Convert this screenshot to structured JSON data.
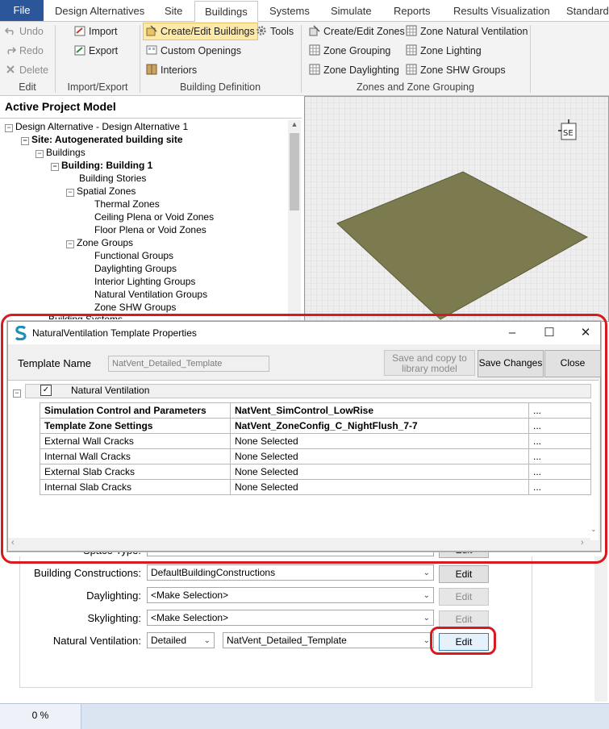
{
  "menu": {
    "file": "File",
    "tabs": [
      "Design Alternatives",
      "Site",
      "Buildings",
      "Systems",
      "Simulate",
      "Reports",
      "Results Visualization",
      "Standards"
    ]
  },
  "ribbon": {
    "edit": {
      "undo": "Undo",
      "redo": "Redo",
      "delete": "Delete",
      "label": "Edit"
    },
    "import_export": {
      "import": "Import",
      "export": "Export",
      "label": "Import/Export"
    },
    "building_definition": {
      "create_edit": "Create/Edit Buildings",
      "tools": "Tools",
      "custom_openings": "Custom Openings",
      "interiors": "Interiors",
      "label": "Building Definition"
    },
    "zones": {
      "create_edit_zones": "Create/Edit Zones",
      "zone_nat_vent": "Zone Natural Ventilation",
      "zone_grouping": "Zone Grouping",
      "zone_lighting": "Zone Lighting",
      "zone_daylighting": "Zone Daylighting",
      "zone_shw": "Zone SHW Groups",
      "label": "Zones and Zone Grouping"
    }
  },
  "left_panel": {
    "title": "Active Project Model",
    "tree": [
      "Design Alternative - Design Alternative 1",
      "Site: Autogenerated building site",
      "Buildings",
      "Building: Building 1",
      "Building Stories",
      "Spatial Zones",
      "Thermal Zones",
      "Ceiling Plena or Void Zones",
      "Floor Plena or Void Zones",
      "Zone Groups",
      "Functional Groups",
      "Daylighting Groups",
      "Interior Lighting Groups",
      "Natural Ventilation Groups",
      "Zone SHW Groups",
      "Building Systems"
    ]
  },
  "dialog": {
    "title": "NaturalVentilation Template Properties",
    "template_name_label": "Template Name",
    "template_name_value": "NatVent_Detailed_Template",
    "save_copy_label": "Save and copy to library model",
    "save_changes_label": "Save Changes",
    "close_label": "Close",
    "section_label": "Natural Ventilation",
    "rows": [
      {
        "name": "Simulation Control and Parameters",
        "value": "NatVent_SimControl_LowRise",
        "bold": true,
        "ellipsis": "..."
      },
      {
        "name": "Template Zone Settings",
        "value": "NatVent_ZoneConfig_C_NightFlush_7-7",
        "bold": true,
        "ellipsis": "..."
      },
      {
        "name": "External Wall Cracks",
        "value": "None Selected",
        "bold": false,
        "ellipsis": "..."
      },
      {
        "name": "Internal Wall Cracks",
        "value": "None Selected",
        "bold": false,
        "ellipsis": "..."
      },
      {
        "name": "External Slab Cracks",
        "value": "None Selected",
        "bold": false,
        "ellipsis": "..."
      },
      {
        "name": "Internal Slab Cracks",
        "value": "None Selected",
        "bold": false,
        "ellipsis": "..."
      }
    ]
  },
  "form": {
    "space_type_label": "Space Type:",
    "space_type_edit": "Edit",
    "building_constructions_label": "Building Constructions:",
    "building_constructions_value": "DefaultBuildingConstructions",
    "building_constructions_edit": "Edit",
    "daylighting_label": "Daylighting:",
    "daylighting_value": "<Make Selection>",
    "daylighting_edit": "Edit",
    "skylighting_label": "Skylighting:",
    "skylighting_value": "<Make Selection>",
    "skylighting_edit": "Edit",
    "natvent_label": "Natural Ventilation:",
    "natvent_mode": "Detailed",
    "natvent_template": "NatVent_Detailed_Template",
    "natvent_edit": "Edit"
  },
  "status": {
    "progress_text": "0 %"
  },
  "colors": {
    "accent": "#2b579a",
    "highlight_ring": "#d8191f",
    "floor_plate": "#7c7a4f"
  }
}
